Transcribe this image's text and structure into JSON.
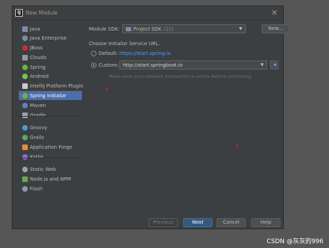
{
  "window": {
    "title": "New Module",
    "app_icon_text": "IJ",
    "close_glyph": "✕"
  },
  "sidebar": {
    "items": [
      {
        "label": "Java",
        "icon": "folder-icon",
        "color": "#7d8ea3"
      },
      {
        "label": "Java Enterprise",
        "icon": "folder-icon",
        "color": "#7d8ea3"
      },
      {
        "label": "JBoss",
        "icon": "jboss-icon",
        "color": "#c8302a"
      },
      {
        "label": "Clouds",
        "icon": "cloud-icon",
        "color": "#8f9aa5"
      },
      {
        "label": "Spring",
        "icon": "spring-icon",
        "color": "#6db33f"
      },
      {
        "label": "Android",
        "icon": "android-icon",
        "color": "#78c257"
      },
      {
        "label": "IntelliJ Platform Plugin",
        "icon": "plugin-icon",
        "color": "#c9c9c9"
      },
      {
        "label": "Spring Initializr",
        "icon": "spring-initializr-icon",
        "color": "#6db33f"
      },
      {
        "label": "Maven",
        "icon": "maven-icon",
        "color": "#5e7fc1"
      },
      {
        "label": "Gradle",
        "icon": "gradle-icon",
        "color": "#9aa3ab"
      },
      {
        "label": "Groovy",
        "icon": "groovy-icon",
        "color": "#4aa0c8"
      },
      {
        "label": "Grails",
        "icon": "grails-icon",
        "color": "#5ea85a"
      },
      {
        "label": "Application Forge",
        "icon": "forge-icon",
        "color": "#e58e2c"
      },
      {
        "label": "Kotlin",
        "icon": "kotlin-icon",
        "color": "#8a6cd6"
      },
      {
        "label": "Static Web",
        "icon": "globe-icon",
        "color": "#9aa3ab"
      },
      {
        "label": "Node.js and NPM",
        "icon": "nodejs-icon",
        "color": "#6aa84f"
      },
      {
        "label": "Flash",
        "icon": "flash-icon",
        "color": "#8f9aa5"
      }
    ],
    "selected_index": 7
  },
  "module_sdk": {
    "label": "Module SDK:",
    "value_prefix": "Project SDK",
    "value_version": "(11)",
    "new_button": "New..."
  },
  "initializr": {
    "heading": "Choose Initializr Service URL.",
    "default_label": "Default:",
    "default_url": "https://start.spring.io",
    "custom_label": "Custom:",
    "custom_url": "http://start.springboot.io",
    "selected": "custom",
    "hint": "Make sure your network connection is active before continuing."
  },
  "footer": {
    "previous": "Previous",
    "next": "Next",
    "cancel": "Cancel",
    "help": "Help"
  },
  "watermark": "CSDN @灰灰的996",
  "colors": {
    "background": "#565656",
    "dialog": "#3c3f41",
    "selection": "#4b6eaf",
    "link": "#589df6",
    "primary_button": "#365880",
    "annotation_dot": "#e0182a"
  }
}
